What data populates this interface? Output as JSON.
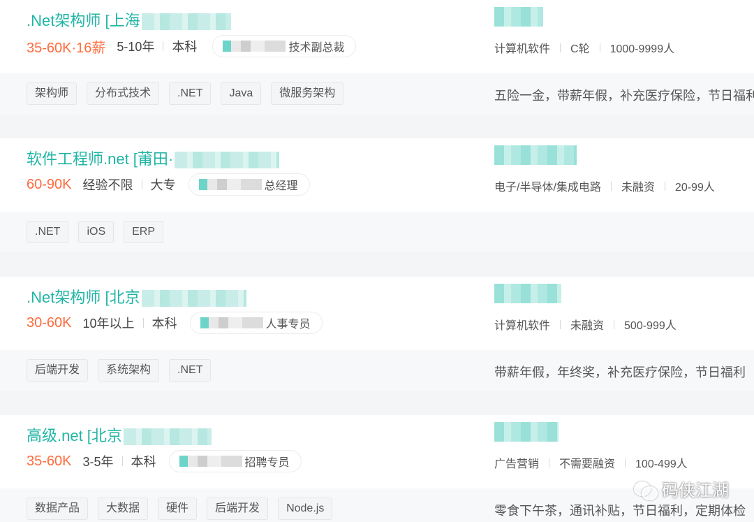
{
  "jobs": [
    {
      "title": ".Net架构师  [上海",
      "salary": "35-60K·16薪",
      "experience": "5-10年",
      "education": "本科",
      "recruiter_title": "技术副总裁",
      "industry": "计算机软件",
      "stage": "C轮",
      "size": "1000-9999人",
      "tags": [
        "架构师",
        "分布式技术",
        ".NET",
        "Java",
        "微服务架构"
      ],
      "benefits": "五险一金，带薪年假，补充医疗保险，节日福利"
    },
    {
      "title": "软件工程师.net  [莆田·",
      "salary": "60-90K",
      "experience": "经验不限",
      "education": "大专",
      "recruiter_title": "总经理",
      "industry": "电子/半导体/集成电路",
      "stage": "未融资",
      "size": "20-99人",
      "tags": [
        ".NET",
        "iOS",
        "ERP"
      ],
      "benefits": ""
    },
    {
      "title": ".Net架构师  [北京",
      "salary": "30-60K",
      "experience": "10年以上",
      "education": "本科",
      "recruiter_title": "人事专员",
      "industry": "计算机软件",
      "stage": "未融资",
      "size": "500-999人",
      "tags": [
        "后端开发",
        "系统架构",
        ".NET"
      ],
      "benefits": "带薪年假，年终奖，补充医疗保险，节日福利"
    },
    {
      "title": "高级.net  [北京",
      "salary": "35-60K",
      "experience": "3-5年",
      "education": "本科",
      "recruiter_title": "招聘专员",
      "industry": "广告营销",
      "stage": "不需要融资",
      "size": "100-499人",
      "tags": [
        "数据产品",
        "大数据",
        "硬件",
        "后端开发",
        "Node.js"
      ],
      "benefits": "零食下午茶，通讯补贴，节日福利，定期体检"
    }
  ],
  "watermark": {
    "text": "码侠江湖",
    "icon": "wechat-icon"
  },
  "colors": {
    "title": "#20b5a5",
    "salary": "#ff6b3d",
    "text": "#555555",
    "background": "#f4f5f7"
  }
}
